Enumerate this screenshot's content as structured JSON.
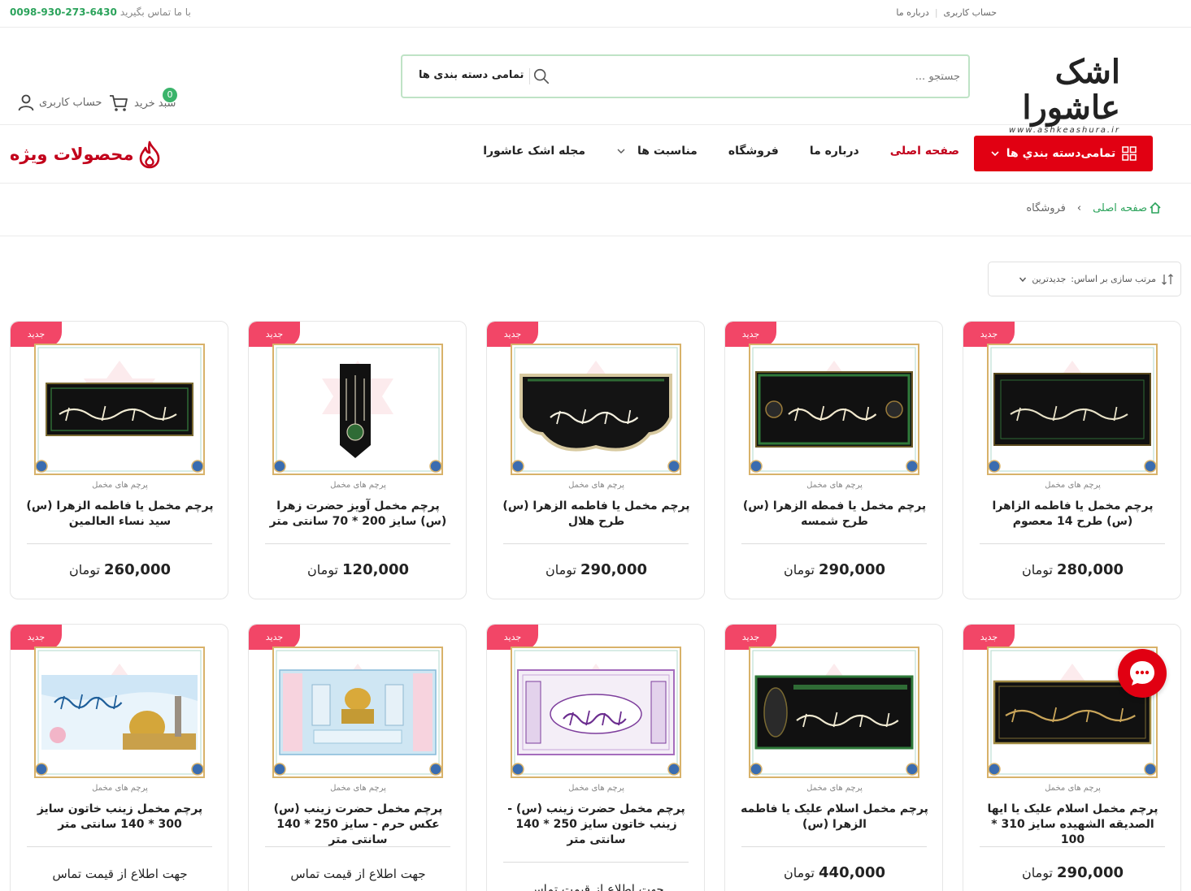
{
  "topbar": {
    "account_label": "حساب کاربری",
    "about_label": "درباره ما",
    "contact_text": "با ما تماس بگیرید",
    "phone": "0098-930-273-6430"
  },
  "header": {
    "logo_text": "اشک عاشورا",
    "logo_url": "www.ashkeashura.ir",
    "search_placeholder": "جستجو ...",
    "search_category": "تمامی دسته بندی ها",
    "cart_label": "سبد خرید",
    "cart_count": "0",
    "account_label": "حساب کاربری"
  },
  "nav": {
    "categories_button": "تمامی‌دسته بندي ها",
    "items": [
      "صفحه اصلی",
      "درباره ما",
      "فروشگاه",
      "مناسبت ها",
      "مجله اشک عاشورا"
    ],
    "special": "محصولات ویژه"
  },
  "breadcrumb": {
    "home": "صفحه اصلی",
    "current": "فروشگاه"
  },
  "sort": {
    "label": "مرتب سازی بر اساس:",
    "value": "جدیدترین"
  },
  "colors": {
    "primary_red": "#e10012",
    "brand_green": "#2ba35b",
    "badge_pink": "#f24667"
  },
  "products": [
    {
      "badge": "جدید",
      "category": "پرچم های مخمل",
      "title": "پرچم مخمل یا فاطمه الزاهرا (س) طرح 14 معصوم",
      "price": "280,000",
      "currency": "تومان"
    },
    {
      "badge": "جدید",
      "category": "پرچم های مخمل",
      "title": "پرچم مخمل یا فمطه الزهرا (س) طرح شمسه",
      "price": "290,000",
      "currency": "تومان"
    },
    {
      "badge": "جدید",
      "category": "پرچم های مخمل",
      "title": "پرچم مخمل یا فاطمه الزهرا (س) طرح هلال",
      "price": "290,000",
      "currency": "تومان"
    },
    {
      "badge": "جدید",
      "category": "پرچم های مخمل",
      "title": "پرچم مخمل آویز حضرت زهرا (س) سایز 200 * 70 سانتی متر",
      "price": "120,000",
      "currency": "تومان"
    },
    {
      "badge": "جدید",
      "category": "پرچم های مخمل",
      "title": "پرچم مخمل یا فاطمه الزهرا (س) سید نساء العالمین",
      "price": "260,000",
      "currency": "تومان"
    },
    {
      "badge": "جدید",
      "category": "پرچم های مخمل",
      "title": "پرچم مخمل اسلام علیک یا ایها الصدیقه الشهیده سایز 310 * 100",
      "price": "290,000",
      "currency": "تومان"
    },
    {
      "badge": "جدید",
      "category": "پرچم های مخمل",
      "title": "پرچم مخمل اسلام علیک یا فاطمه الزهرا (س)",
      "price": "440,000",
      "currency": "تومان"
    },
    {
      "badge": "جدید",
      "category": "پرچم های مخمل",
      "title": "پرچم مخمل حضرت زینب (س) - زینب خاتون سایز 250 * 140 سانتی متر",
      "contact": "جهت اطلاع از قیمت تماس"
    },
    {
      "badge": "جدید",
      "category": "پرچم های مخمل",
      "title": "پرچم مخمل حضرت زینب (س) عکس حرم - سایز 250 * 140 سانتی متر",
      "contact": "جهت اطلاع از قیمت تماس"
    },
    {
      "badge": "جدید",
      "category": "پرچم های مخمل",
      "title": "پرچم مخمل زینب خاتون سایز 300 * 140 سانتی متر",
      "contact": "جهت اطلاع از قیمت تماس"
    }
  ]
}
